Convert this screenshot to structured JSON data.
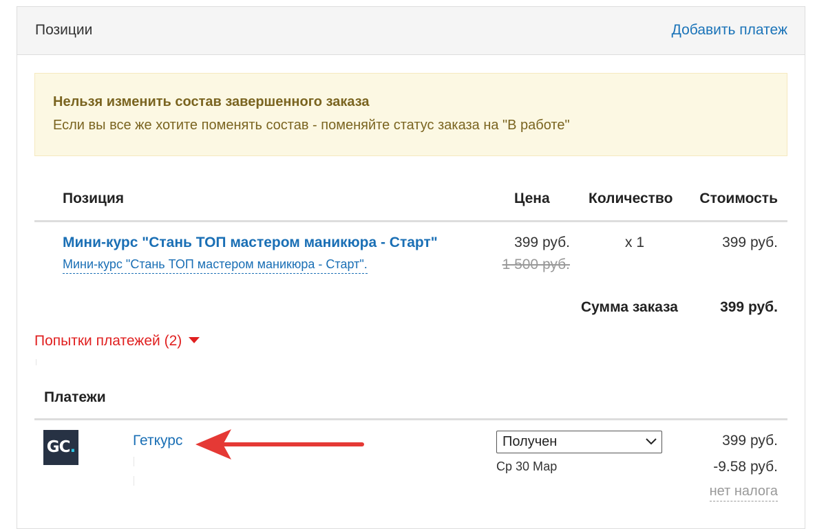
{
  "header": {
    "title": "Позиции",
    "add_payment_label": "Добавить платеж"
  },
  "alert": {
    "title": "Нельзя изменить состав завершенного заказа",
    "text": "Если вы все же хотите поменять состав - поменяйте статус заказа на \"В работе\""
  },
  "table": {
    "headers": {
      "position": "Позиция",
      "price": "Цена",
      "quantity": "Количество",
      "cost": "Стоимость"
    },
    "rows": [
      {
        "product": "Мини-курс \"Стань ТОП мастером маникюра - Старт\"",
        "offer": "Мини-курс \"Стань ТОП мастером маникюра - Старт\".",
        "price": "399 руб.",
        "old_price": "1 500 руб.",
        "quantity": "x 1",
        "cost": "399 руб."
      }
    ],
    "total_label": "Сумма заказа",
    "total_value": "399 руб."
  },
  "attempts": {
    "label": "Попытки платежей (2)",
    "icon": "caret-down-icon",
    "color": "#e02020"
  },
  "payments": {
    "title": "Платежи",
    "items": [
      {
        "logo_text": "GC",
        "logo_dot": ".",
        "gateway": "Геткурс",
        "status": "Получен",
        "date": "Ср 30 Мар",
        "amount": "399 руб.",
        "fee": "-9.58 руб.",
        "tax": "нет налога"
      }
    ]
  },
  "colors": {
    "link": "#1a6fb5",
    "alert_bg": "#fcf8e3",
    "alert_text": "#7a6420",
    "arrow": "#e53935",
    "logo_bg": "#273244",
    "logo_accent": "#2cc5e4"
  }
}
